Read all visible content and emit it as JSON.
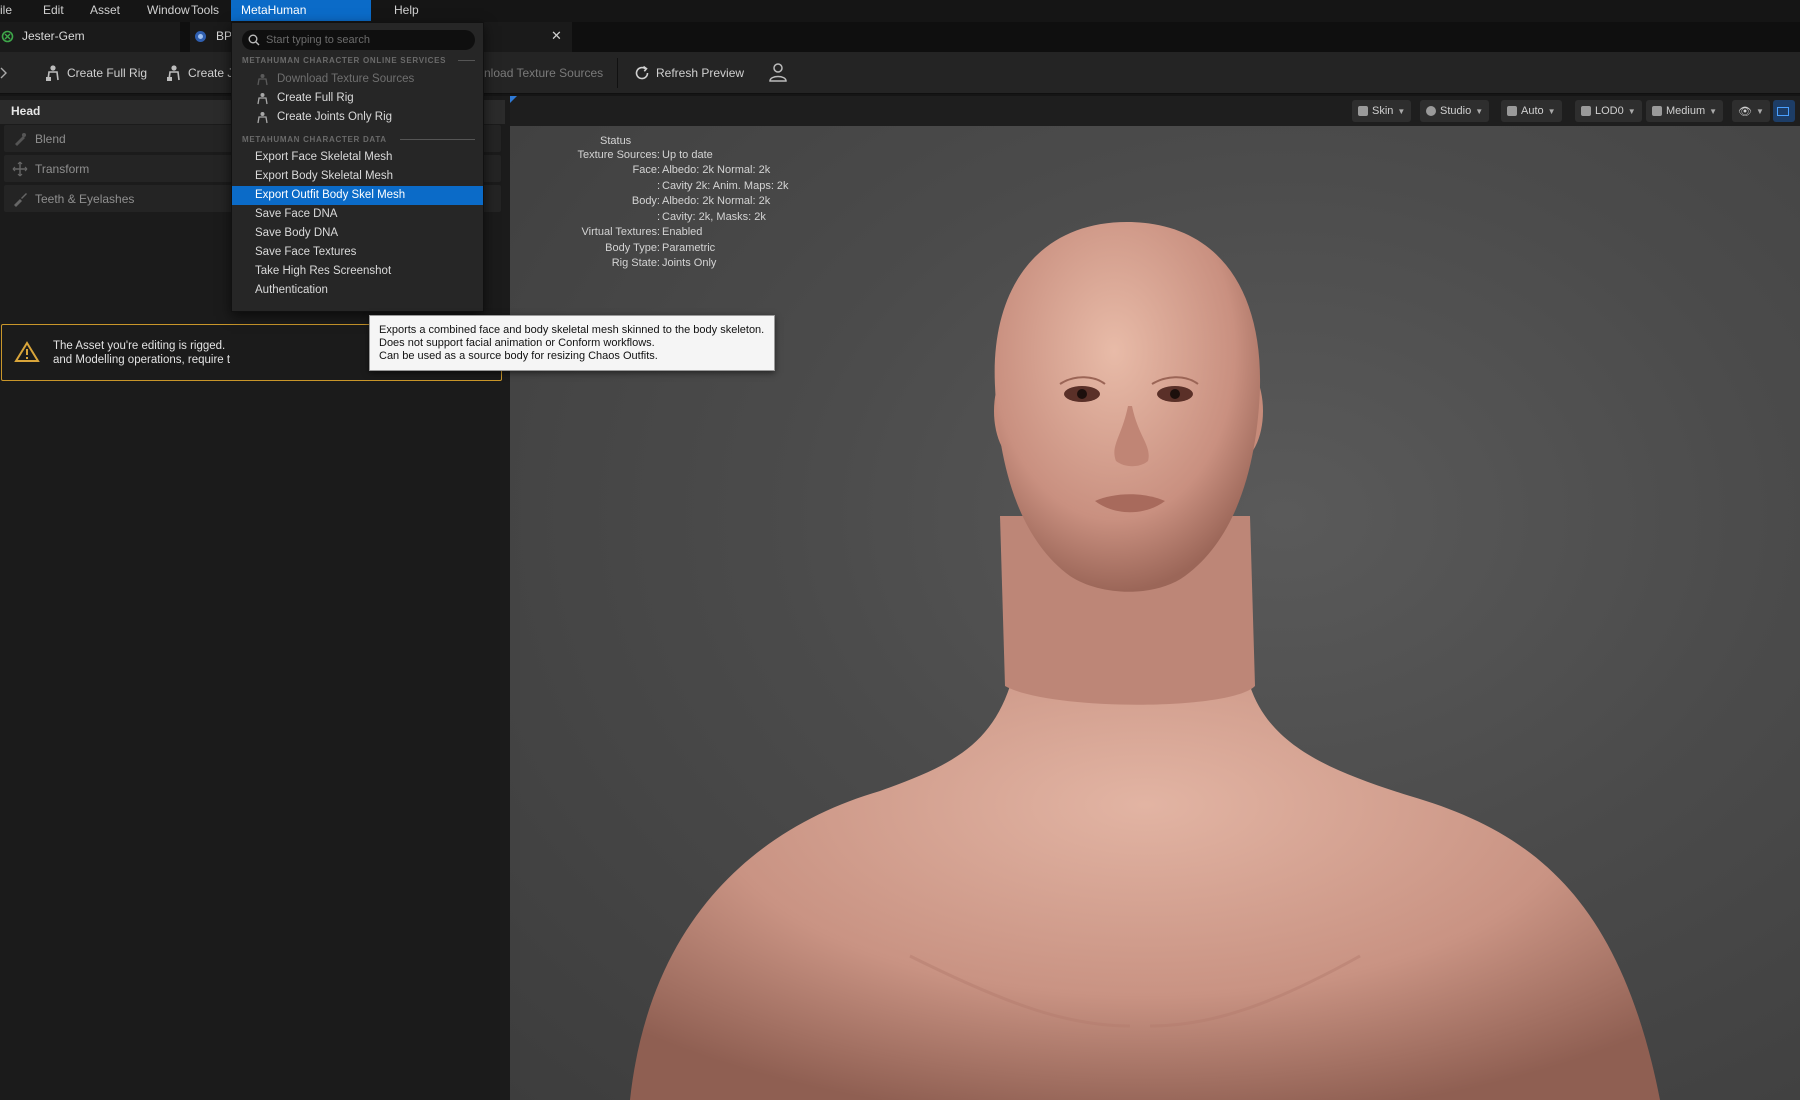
{
  "menubar": {
    "items": [
      "ile",
      "Edit",
      "Asset",
      "Window",
      "Tools",
      "MetaHuman Character",
      "Help"
    ]
  },
  "tabs": {
    "asset_tab": "Jester-Gem",
    "bp_tab": "BP"
  },
  "toolbar": {
    "create_full_rig": "Create Full Rig",
    "create_joints": "Create Jo",
    "download_texture_sources": "nload Texture Sources",
    "refresh_preview": "Refresh Preview"
  },
  "left_panel": {
    "header": "Head",
    "rows": [
      "Blend",
      "Transform",
      "Teeth & Eyelashes"
    ],
    "warning_text": "The Asset you're editing is rigged.\nand Modelling operations, require t"
  },
  "viewport": {
    "buttons": {
      "skin": "Skin",
      "studio": "Studio",
      "auto": "Auto",
      "lod": "LOD0",
      "quality": "Medium"
    },
    "status": {
      "title": "Status",
      "rows": [
        {
          "key": "Texture Sources:",
          "value": "Up to date"
        },
        {
          "key": "Face:",
          "value": "Albedo: 2k Normal: 2k"
        },
        {
          "key": ":",
          "value": "Cavity 2k: Anim. Maps: 2k"
        },
        {
          "key": "Body:",
          "value": "Albedo: 2k Normal: 2k"
        },
        {
          "key": ":",
          "value": "Cavity: 2k, Masks: 2k"
        },
        {
          "key": "Virtual Textures:",
          "value": "Enabled"
        },
        {
          "key": "Body Type:",
          "value": "Parametric"
        },
        {
          "key": "Rig State:",
          "value": "Joints Only"
        }
      ]
    }
  },
  "dropdown": {
    "search_placeholder": "Start typing to search",
    "section_online": "METAHUMAN CHARACTER ONLINE SERVICES",
    "section_data": "METAHUMAN CHARACTER DATA",
    "online_items": [
      "Download Texture Sources",
      "Create Full Rig",
      "Create Joints Only Rig"
    ],
    "data_items": [
      "Export Face Skeletal Mesh",
      "Export Body Skeletal Mesh",
      "Export Outfit Body Skel Mesh",
      "Save Face DNA",
      "Save Body DNA",
      "Save Face Textures",
      "Take High Res Screenshot",
      "Authentication"
    ],
    "highlighted": "Export Outfit Body Skel Mesh"
  },
  "tooltip": {
    "lines": [
      "Exports a combined face and body skeletal mesh skinned to the body skeleton.",
      "Does not support facial animation or Conform workflows.",
      "Can be used as a source body for resizing Chaos Outfits."
    ]
  },
  "colors": {
    "accent": "#0b6bc8",
    "warning_border": "#c9962a",
    "skin_tone": "#d8a694"
  }
}
